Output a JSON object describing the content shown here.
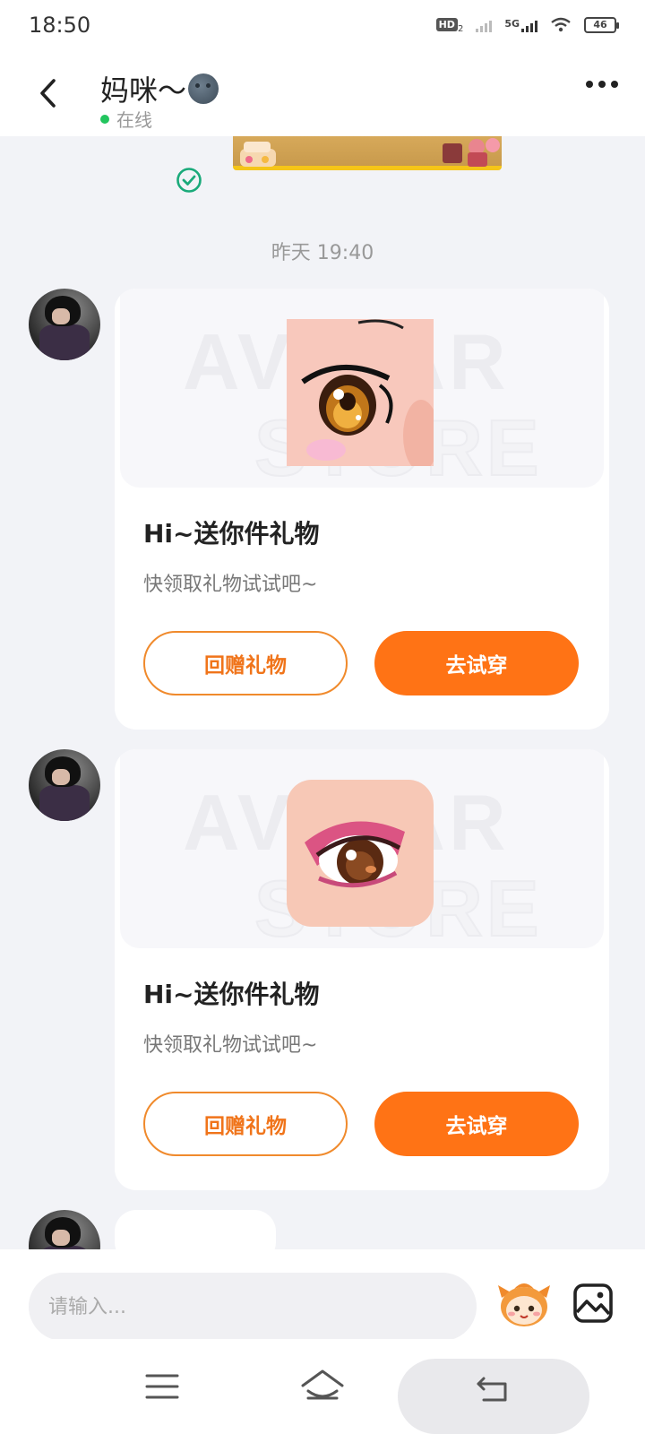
{
  "status_bar": {
    "time": "18:50",
    "hd_label": "HD",
    "hd_sub": "2",
    "network": "5G",
    "battery": "46"
  },
  "header": {
    "title": "妈咪～",
    "status": "在线",
    "back_icon": "chevron-left-icon",
    "more_icon": "more-dots-icon"
  },
  "chat": {
    "timestamp": "昨天 19:40",
    "watermark_line1": "AVATAR",
    "watermark_line2": "STORE",
    "messages": [
      {
        "title": "Hi~送你件礼物",
        "subtitle": "快领取礼物试试吧~",
        "secondary_button": "回赠礼物",
        "primary_button": "去试穿",
        "gift_icon": "anime-eye-gift"
      },
      {
        "title": "Hi~送你件礼物",
        "subtitle": "快领取礼物试试吧~",
        "secondary_button": "回赠礼物",
        "primary_button": "去试穿",
        "gift_icon": "eye-makeup-gift"
      }
    ]
  },
  "input": {
    "placeholder": "请输入..."
  },
  "colors": {
    "accent": "#ff7315",
    "outline": "#f08a2c",
    "online": "#22c55e",
    "check": "#1aaa7a",
    "background": "#f2f3f7"
  }
}
